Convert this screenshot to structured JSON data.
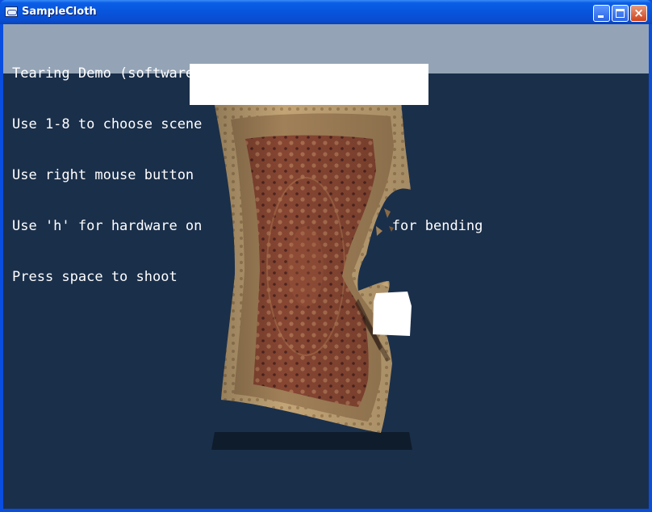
{
  "window": {
    "title": "SampleCloth",
    "controls": {
      "minimize": "minimize",
      "maximize": "maximize",
      "close": "×"
    }
  },
  "hud": {
    "lines": [
      "Tearing Demo (software/full tear)",
      "Use 1-8 to choose scene",
      "Use right mouse button",
      "Use 'h' for hardware on                       for bending",
      "Press space to shoot"
    ]
  },
  "scene": {
    "background_color": "#1a2f4a",
    "objects": [
      "torn-persian-rug-cloth",
      "white-cube-projectile",
      "ground-slab"
    ],
    "rug_colors": {
      "border": "#c4a878",
      "border_dark": "#7a5a38",
      "field": "#8a4a34",
      "field_dark": "#5a2a22",
      "pattern": "#c8906a"
    }
  }
}
